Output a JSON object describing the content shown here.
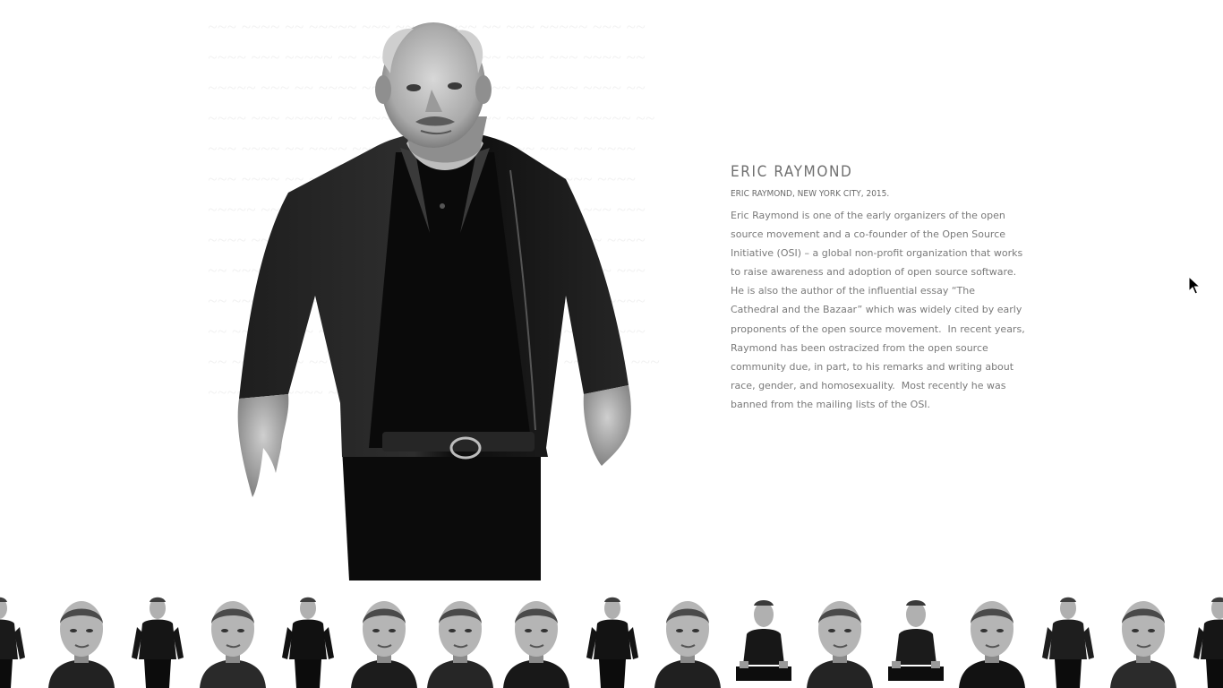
{
  "person": {
    "name": "ERIC RAYMOND",
    "caption": "ERIC RAYMOND, NEW YORK CITY, 2015.",
    "bio": "Eric Raymond is one of the early organizers of the open source movement and a co-founder of the Open Source Initiative (OSI) – a global non-profit organization that works to raise awareness and adoption of open source software. He is also the author of the influential essay “The Cathedral and the Bazaar” which was widely cited by early proponents of the open source movement.  In recent years, Raymond has been ostracized from the open source community due, in part, to his remarks and writing about race, gender, and homosexuality.  Most recently he was banned from the mailing lists of the OSI."
  },
  "colors": {
    "background": "#ffffff",
    "name_text": "#6f6f6f",
    "body_text": "#7a7a7a"
  },
  "filmstrip": {
    "thumbnail_count": 17,
    "style": "black-and-white portrait thumbnails"
  }
}
